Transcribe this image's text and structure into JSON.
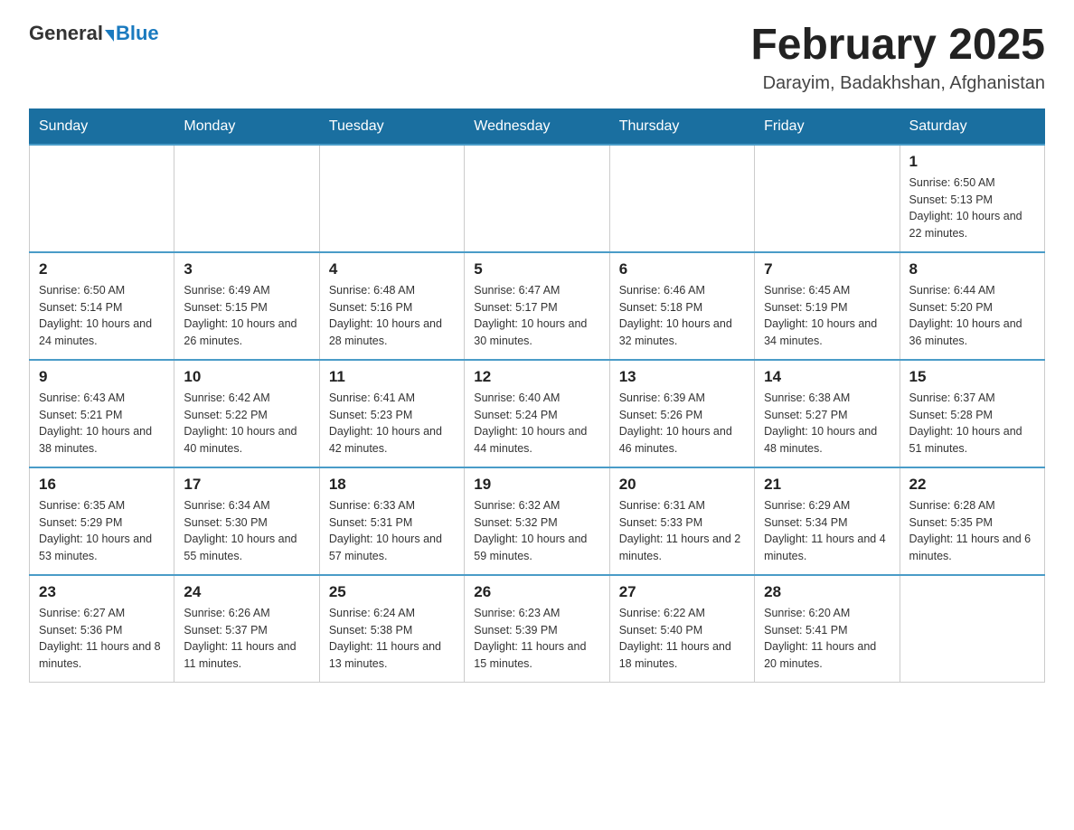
{
  "logo": {
    "general": "General",
    "blue": "Blue"
  },
  "title": "February 2025",
  "subtitle": "Darayim, Badakhshan, Afghanistan",
  "weekdays": [
    "Sunday",
    "Monday",
    "Tuesday",
    "Wednesday",
    "Thursday",
    "Friday",
    "Saturday"
  ],
  "rows": [
    [
      {
        "day": "",
        "info": ""
      },
      {
        "day": "",
        "info": ""
      },
      {
        "day": "",
        "info": ""
      },
      {
        "day": "",
        "info": ""
      },
      {
        "day": "",
        "info": ""
      },
      {
        "day": "",
        "info": ""
      },
      {
        "day": "1",
        "info": "Sunrise: 6:50 AM\nSunset: 5:13 PM\nDaylight: 10 hours and 22 minutes."
      }
    ],
    [
      {
        "day": "2",
        "info": "Sunrise: 6:50 AM\nSunset: 5:14 PM\nDaylight: 10 hours and 24 minutes."
      },
      {
        "day": "3",
        "info": "Sunrise: 6:49 AM\nSunset: 5:15 PM\nDaylight: 10 hours and 26 minutes."
      },
      {
        "day": "4",
        "info": "Sunrise: 6:48 AM\nSunset: 5:16 PM\nDaylight: 10 hours and 28 minutes."
      },
      {
        "day": "5",
        "info": "Sunrise: 6:47 AM\nSunset: 5:17 PM\nDaylight: 10 hours and 30 minutes."
      },
      {
        "day": "6",
        "info": "Sunrise: 6:46 AM\nSunset: 5:18 PM\nDaylight: 10 hours and 32 minutes."
      },
      {
        "day": "7",
        "info": "Sunrise: 6:45 AM\nSunset: 5:19 PM\nDaylight: 10 hours and 34 minutes."
      },
      {
        "day": "8",
        "info": "Sunrise: 6:44 AM\nSunset: 5:20 PM\nDaylight: 10 hours and 36 minutes."
      }
    ],
    [
      {
        "day": "9",
        "info": "Sunrise: 6:43 AM\nSunset: 5:21 PM\nDaylight: 10 hours and 38 minutes."
      },
      {
        "day": "10",
        "info": "Sunrise: 6:42 AM\nSunset: 5:22 PM\nDaylight: 10 hours and 40 minutes."
      },
      {
        "day": "11",
        "info": "Sunrise: 6:41 AM\nSunset: 5:23 PM\nDaylight: 10 hours and 42 minutes."
      },
      {
        "day": "12",
        "info": "Sunrise: 6:40 AM\nSunset: 5:24 PM\nDaylight: 10 hours and 44 minutes."
      },
      {
        "day": "13",
        "info": "Sunrise: 6:39 AM\nSunset: 5:26 PM\nDaylight: 10 hours and 46 minutes."
      },
      {
        "day": "14",
        "info": "Sunrise: 6:38 AM\nSunset: 5:27 PM\nDaylight: 10 hours and 48 minutes."
      },
      {
        "day": "15",
        "info": "Sunrise: 6:37 AM\nSunset: 5:28 PM\nDaylight: 10 hours and 51 minutes."
      }
    ],
    [
      {
        "day": "16",
        "info": "Sunrise: 6:35 AM\nSunset: 5:29 PM\nDaylight: 10 hours and 53 minutes."
      },
      {
        "day": "17",
        "info": "Sunrise: 6:34 AM\nSunset: 5:30 PM\nDaylight: 10 hours and 55 minutes."
      },
      {
        "day": "18",
        "info": "Sunrise: 6:33 AM\nSunset: 5:31 PM\nDaylight: 10 hours and 57 minutes."
      },
      {
        "day": "19",
        "info": "Sunrise: 6:32 AM\nSunset: 5:32 PM\nDaylight: 10 hours and 59 minutes."
      },
      {
        "day": "20",
        "info": "Sunrise: 6:31 AM\nSunset: 5:33 PM\nDaylight: 11 hours and 2 minutes."
      },
      {
        "day": "21",
        "info": "Sunrise: 6:29 AM\nSunset: 5:34 PM\nDaylight: 11 hours and 4 minutes."
      },
      {
        "day": "22",
        "info": "Sunrise: 6:28 AM\nSunset: 5:35 PM\nDaylight: 11 hours and 6 minutes."
      }
    ],
    [
      {
        "day": "23",
        "info": "Sunrise: 6:27 AM\nSunset: 5:36 PM\nDaylight: 11 hours and 8 minutes."
      },
      {
        "day": "24",
        "info": "Sunrise: 6:26 AM\nSunset: 5:37 PM\nDaylight: 11 hours and 11 minutes."
      },
      {
        "day": "25",
        "info": "Sunrise: 6:24 AM\nSunset: 5:38 PM\nDaylight: 11 hours and 13 minutes."
      },
      {
        "day": "26",
        "info": "Sunrise: 6:23 AM\nSunset: 5:39 PM\nDaylight: 11 hours and 15 minutes."
      },
      {
        "day": "27",
        "info": "Sunrise: 6:22 AM\nSunset: 5:40 PM\nDaylight: 11 hours and 18 minutes."
      },
      {
        "day": "28",
        "info": "Sunrise: 6:20 AM\nSunset: 5:41 PM\nDaylight: 11 hours and 20 minutes."
      },
      {
        "day": "",
        "info": ""
      }
    ]
  ]
}
